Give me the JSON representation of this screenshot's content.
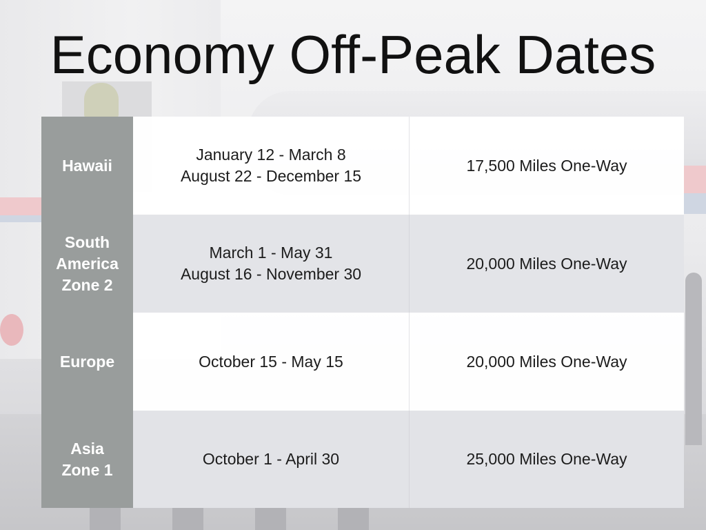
{
  "slide": {
    "title": "Economy Off-Peak Dates"
  },
  "table": {
    "rows": [
      {
        "region": "Hawaii",
        "dates": "January 12 - March 8\nAugust 22 - December 15",
        "miles": "17,500 Miles One-Way"
      },
      {
        "region": "South\nAmerica\nZone 2",
        "dates": "March 1 - May 31\nAugust 16 - November 30",
        "miles": "20,000 Miles One-Way"
      },
      {
        "region": "Europe",
        "dates": "October 15 - May 15",
        "miles": "20,000 Miles One-Way"
      },
      {
        "region": "Asia\nZone 1",
        "dates": "October 1 - April 30",
        "miles": "25,000 Miles One-Way"
      }
    ]
  },
  "colors": {
    "region_column": "#999d9c",
    "row_light": "#ffffff",
    "row_shade": "#e2e3e7",
    "text_dark": "#1c1c1c",
    "title_text": "#111111"
  }
}
